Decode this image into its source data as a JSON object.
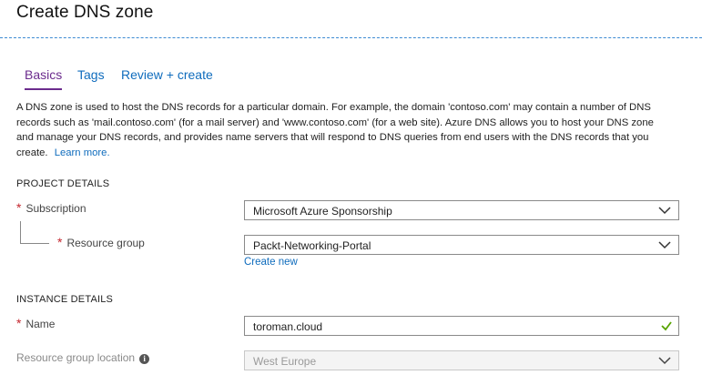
{
  "title": "Create DNS zone",
  "tabs": [
    {
      "label": "Basics",
      "active": true
    },
    {
      "label": "Tags",
      "active": false
    },
    {
      "label": "Review + create",
      "active": false
    }
  ],
  "description": {
    "text": "A DNS zone is used to host the DNS records for a particular domain. For example, the domain 'contoso.com' may contain a number of DNS records such as 'mail.contoso.com' (for a mail server) and 'www.contoso.com' (for a web site). Azure DNS allows you to host your DNS zone and manage your DNS records, and provides name servers that will respond to DNS queries from end users with the DNS records that you create.",
    "link": "Learn more."
  },
  "project_details": {
    "heading": "PROJECT DETAILS",
    "subscription": {
      "label": "Subscription",
      "value": "Microsoft Azure Sponsorship",
      "icon": "chevron-down-icon"
    },
    "resource_group": {
      "label": "Resource group",
      "value": "Packt-Networking-Portal",
      "icon": "chevron-down-icon",
      "create_new": "Create new"
    }
  },
  "instance_details": {
    "heading": "INSTANCE DETAILS",
    "name": {
      "label": "Name",
      "value": "toroman.cloud",
      "icon": "checkmark-icon",
      "valid_color": "#57a300"
    },
    "location": {
      "label": "Resource group location",
      "value": "West Europe",
      "icon": "chevron-down-icon",
      "info_icon": "i"
    }
  },
  "colors": {
    "accent": "#0f6cbd",
    "active_tab": "#6b2b8d",
    "required": "#c4262e",
    "dashed_rule": "#3d8bd3"
  }
}
